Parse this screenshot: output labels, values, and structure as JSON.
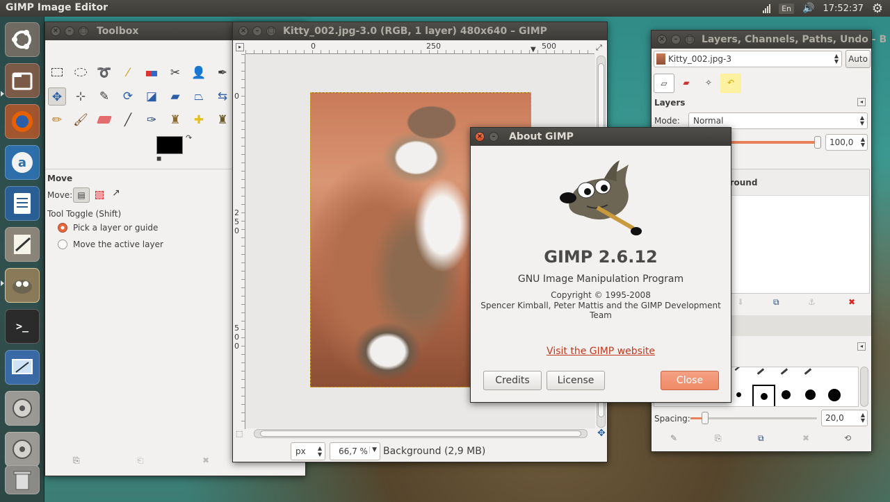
{
  "topbar": {
    "app_title": "GIMP Image Editor",
    "keyboard": "En",
    "clock": "17:52:37",
    "icons": [
      "network-icon",
      "keyboard-indicator",
      "volume-icon",
      "settings-gear-icon"
    ]
  },
  "launcher": {
    "items": [
      "ubuntu-dash-icon",
      "files-icon",
      "firefox-icon",
      "software-center-icon",
      "libreoffice-writer-icon",
      "text-editor-icon",
      "gimp-icon",
      "terminal-icon",
      "screenshot-app-icon",
      "disk-icon",
      "disk-icon-2",
      "trash-icon"
    ]
  },
  "toolbox": {
    "title": "Toolbox",
    "tool_options_title": "Move",
    "move_label": "Move:",
    "tool_toggle_label": "Tool Toggle  (Shift)",
    "radio_options": [
      "Pick a layer or guide",
      "Move the active layer"
    ],
    "selected_radio": 0
  },
  "image_window": {
    "title": "Kitty_002.jpg-3.0 (RGB, 1 layer) 480x640 – GIMP",
    "ruler_h_ticks": [
      "0",
      "250",
      "500"
    ],
    "ruler_v_ticks": [
      "0",
      "2\n5\n0",
      "5\n0\n0"
    ],
    "unit": "px",
    "zoom": "66,7 %",
    "status": "Background (2,9 MB)"
  },
  "layers": {
    "title": "Layers, Channels, Paths, Undo - B",
    "image_menu": "Kitty_002.jpg-3",
    "auto_label": "Auto",
    "section_title": "Layers",
    "mode_label": "Mode:",
    "mode_value": "Normal",
    "opacity_value": "100,0",
    "layer_name": "ground",
    "spacing_label": "Spacing:",
    "spacing_value": "20,0"
  },
  "about": {
    "title": "About GIMP",
    "app_name": "GIMP 2.6.12",
    "full_name": "GNU Image Manipulation Program",
    "copyright": "Copyright © 1995-2008",
    "authors": "Spencer Kimball, Peter Mattis and the GIMP Development Team",
    "website_link": "Visit the GIMP website",
    "credits_button": "Credits",
    "license_button": "License",
    "close_button": "Close"
  },
  "colors": {
    "accent": "#ef8a66",
    "title_bar": "#3c3b37",
    "link": "#c0391f"
  }
}
